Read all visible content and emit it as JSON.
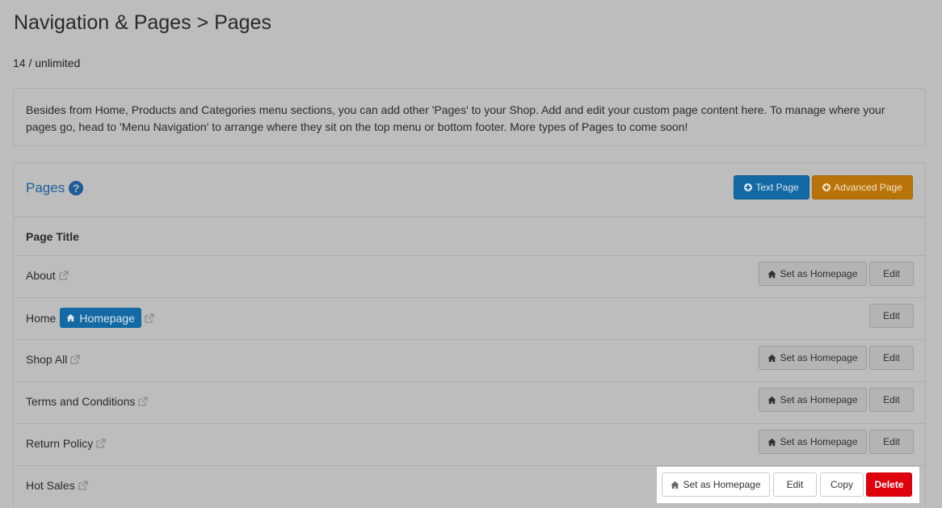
{
  "header": {
    "title": "Navigation & Pages > Pages",
    "count": "14 / unlimited"
  },
  "info": {
    "text": "Besides from Home, Products and Categories menu sections, you can add other 'Pages' to your Shop. Add and edit your custom page content here. To manage where your pages go, head to 'Menu Navigation' to arrange where they sit on the top menu or bottom footer. More types of Pages to come soon!"
  },
  "panel": {
    "title": "Pages",
    "help_icon": "question-circle-icon",
    "text_page_label": "Text Page",
    "advanced_page_label": "Advanced Page",
    "column_header": "Page Title"
  },
  "actions": {
    "set_home": "Set as Homepage",
    "edit": "Edit",
    "copy": "Copy",
    "delete": "Delete"
  },
  "rows": [
    {
      "title": "About",
      "is_homepage": false
    },
    {
      "title": "Home",
      "is_homepage": true,
      "badge": "Homepage"
    },
    {
      "title": "Shop All",
      "is_homepage": false
    },
    {
      "title": "Terms and Conditions",
      "is_homepage": false
    },
    {
      "title": "Return Policy",
      "is_homepage": false
    },
    {
      "title": "Hot Sales",
      "is_homepage": false,
      "highlighted": true
    }
  ],
  "colors": {
    "primary": "#1369a3",
    "warning": "#b8740a",
    "danger": "#e0000d",
    "link": "#1e5c9a"
  }
}
